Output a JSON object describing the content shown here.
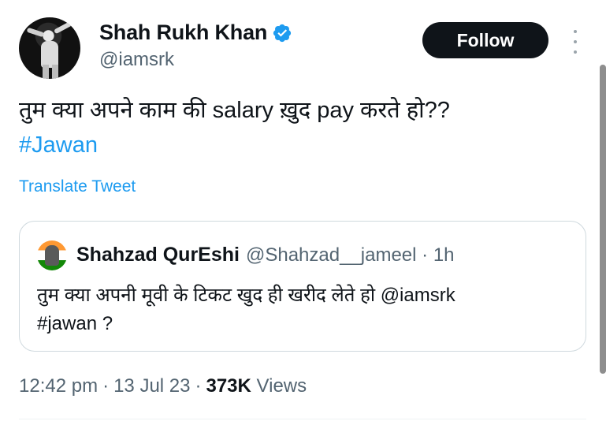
{
  "author": {
    "display_name": "Shah Rukh Khan",
    "handle": "@iamsrk",
    "verified": true,
    "verified_color": "#1d9bf0"
  },
  "header": {
    "follow_label": "Follow",
    "more_icon": "more-vertical-icon"
  },
  "tweet": {
    "text": "तुम क्या अपने काम की salary ख़ुद pay करते हो??",
    "hashtag": "#Jawan",
    "translate_label": "Translate Tweet"
  },
  "quote": {
    "display_name": "Shahzad QurEshi",
    "handle_time": "@Shahzad__jameel · 1h",
    "text_line1": "तुम क्या अपनी मूवी के टिकट खुद ही खरीद लेते हो @iamsrk",
    "text_line2": "#jawan ?"
  },
  "meta": {
    "time": "12:42 pm",
    "sep1": "·",
    "date": "13 Jul 23",
    "sep2": "·",
    "views_count": "373K",
    "views_label": "Views"
  },
  "colors": {
    "link": "#1d9bf0",
    "text": "#0f1419",
    "secondary": "#536471",
    "button_bg": "#0f1419"
  }
}
